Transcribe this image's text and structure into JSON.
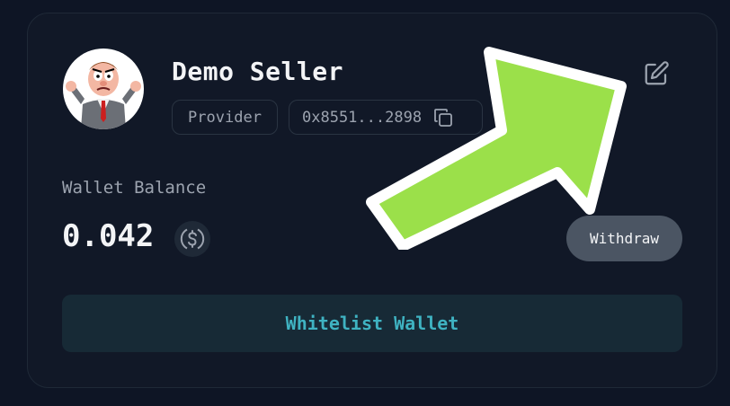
{
  "seller": {
    "name": "Demo Seller",
    "role": "Provider",
    "address": "0x8551...2898"
  },
  "wallet": {
    "label": "Wallet Balance",
    "balance": "0.042",
    "currency_icon": "usdc-dollar-icon"
  },
  "actions": {
    "withdraw_label": "Withdraw",
    "whitelist_label": "Whitelist Wallet"
  },
  "icons": {
    "edit": "edit-icon",
    "copy": "copy-icon",
    "annotation": "green-arrow-icon"
  },
  "colors": {
    "background": "#0e1525",
    "card": "#111827",
    "text_primary": "#f3f4f6",
    "text_muted": "#9ca3af",
    "withdraw_bg": "#4b5563",
    "whitelist_bg": "#172a36",
    "whitelist_text": "#3fb3c2",
    "arrow_green": "#9be04a"
  }
}
